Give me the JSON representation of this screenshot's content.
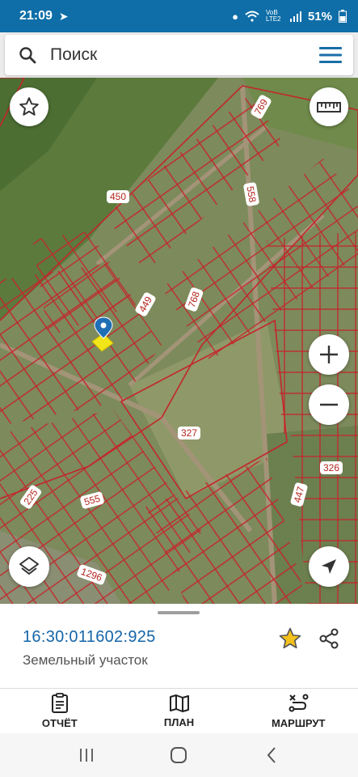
{
  "status_bar": {
    "time": "21:09",
    "network": "VoB LTE2",
    "battery": "51%"
  },
  "search": {
    "placeholder": "Поиск"
  },
  "map": {
    "labels": {
      "l769": "769",
      "l450": "450",
      "l558": "558",
      "l449": "449",
      "l768": "768",
      "l327": "327",
      "l326": "326",
      "l447": "447",
      "l225": "225",
      "l555": "555",
      "l1296": "1296"
    },
    "colors": {
      "parcel_stroke": "#c3262b",
      "selected_parcel": "#f2e51a",
      "marker": "#1f6fb5"
    }
  },
  "sheet": {
    "cadastral_number": "16:30:011602:925",
    "object_type": "Земельный участок"
  },
  "nav": {
    "report": "ОТЧЁТ",
    "plan": "ПЛАН",
    "route": "МАРШРУТ"
  }
}
